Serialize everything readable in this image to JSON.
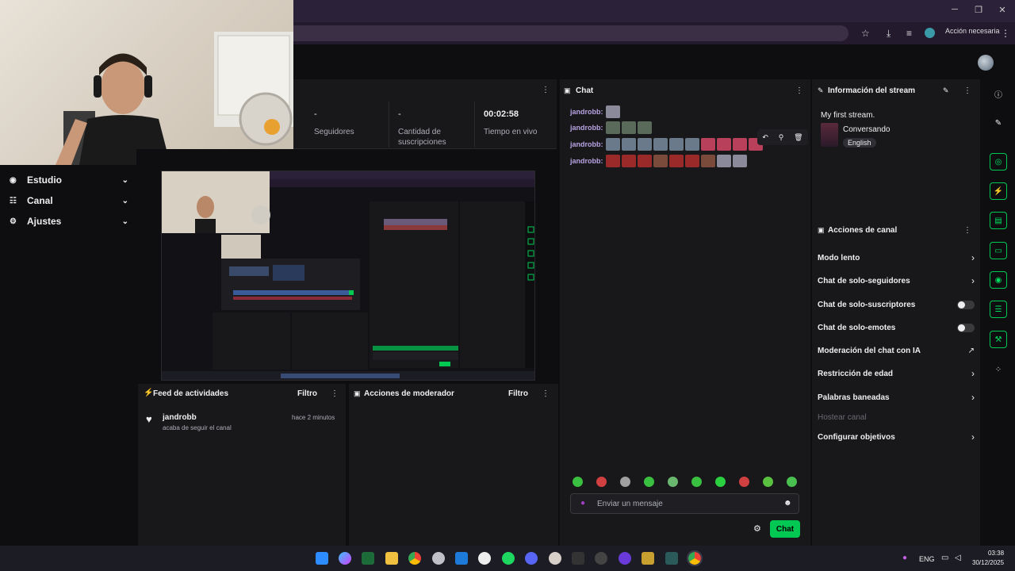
{
  "browser": {
    "window_controls": [
      "─",
      "❐",
      "✕"
    ],
    "action_label": "Acción necesaria"
  },
  "sidebar": {
    "items": [
      {
        "label": "Estudio",
        "icon": "studio-icon"
      },
      {
        "label": "Canal",
        "icon": "channel-icon"
      },
      {
        "label": "Ajustes",
        "icon": "gear-icon"
      }
    ]
  },
  "stats": {
    "followers_value": "-",
    "followers_label": "Seguidores",
    "subs_value": "-",
    "subs_label_1": "Cantidad de",
    "subs_label_2": "suscripciones",
    "live_value": "00:02:58",
    "live_label": "Tiempo en vivo"
  },
  "activity_feed": {
    "title": "Feed de actividades",
    "filter": "Filtro",
    "items": [
      {
        "user": "jandrobb",
        "text": "acaba de seguir el canal",
        "time": "hace 2 minutos"
      }
    ]
  },
  "mod_actions": {
    "title": "Acciones de moderador",
    "filter": "Filtro"
  },
  "chat": {
    "title": "Chat",
    "messages": [
      {
        "user": "jandrobb:"
      },
      {
        "user": "jandrobb:"
      },
      {
        "user": "jandrobb:"
      },
      {
        "user": "jandrobb:"
      }
    ],
    "input_placeholder": "Enviar un mensaje",
    "send_label": "Chat"
  },
  "stream_info": {
    "title": "Información del stream",
    "stream_title": "My first stream.",
    "category": "Conversando",
    "tag": "English"
  },
  "channel_actions": {
    "title": "Acciones de canal",
    "items": [
      {
        "label": "Modo lento",
        "control": "chevron"
      },
      {
        "label": "Chat de solo-seguidores",
        "control": "chevron"
      },
      {
        "label": "Chat de solo-suscriptores",
        "control": "toggle"
      },
      {
        "label": "Chat de solo-emotes",
        "control": "toggle"
      },
      {
        "label": "Moderación del chat con IA",
        "control": "external"
      },
      {
        "label": "Restricción de edad",
        "control": "chevron"
      },
      {
        "label": "Palabras baneadas",
        "control": "chevron"
      },
      {
        "label": "Hostear canal",
        "control": "disabled"
      },
      {
        "label": "Configurar objetivos",
        "control": "chevron"
      }
    ]
  },
  "taskbar": {
    "lang": "ENG",
    "time": "03:38",
    "date": "30/12/2025"
  },
  "colors": {
    "accent": "#00c853",
    "chat_user": "#b9a3e3",
    "panel_bg": "#18181b",
    "page_bg": "#0e0e10"
  }
}
